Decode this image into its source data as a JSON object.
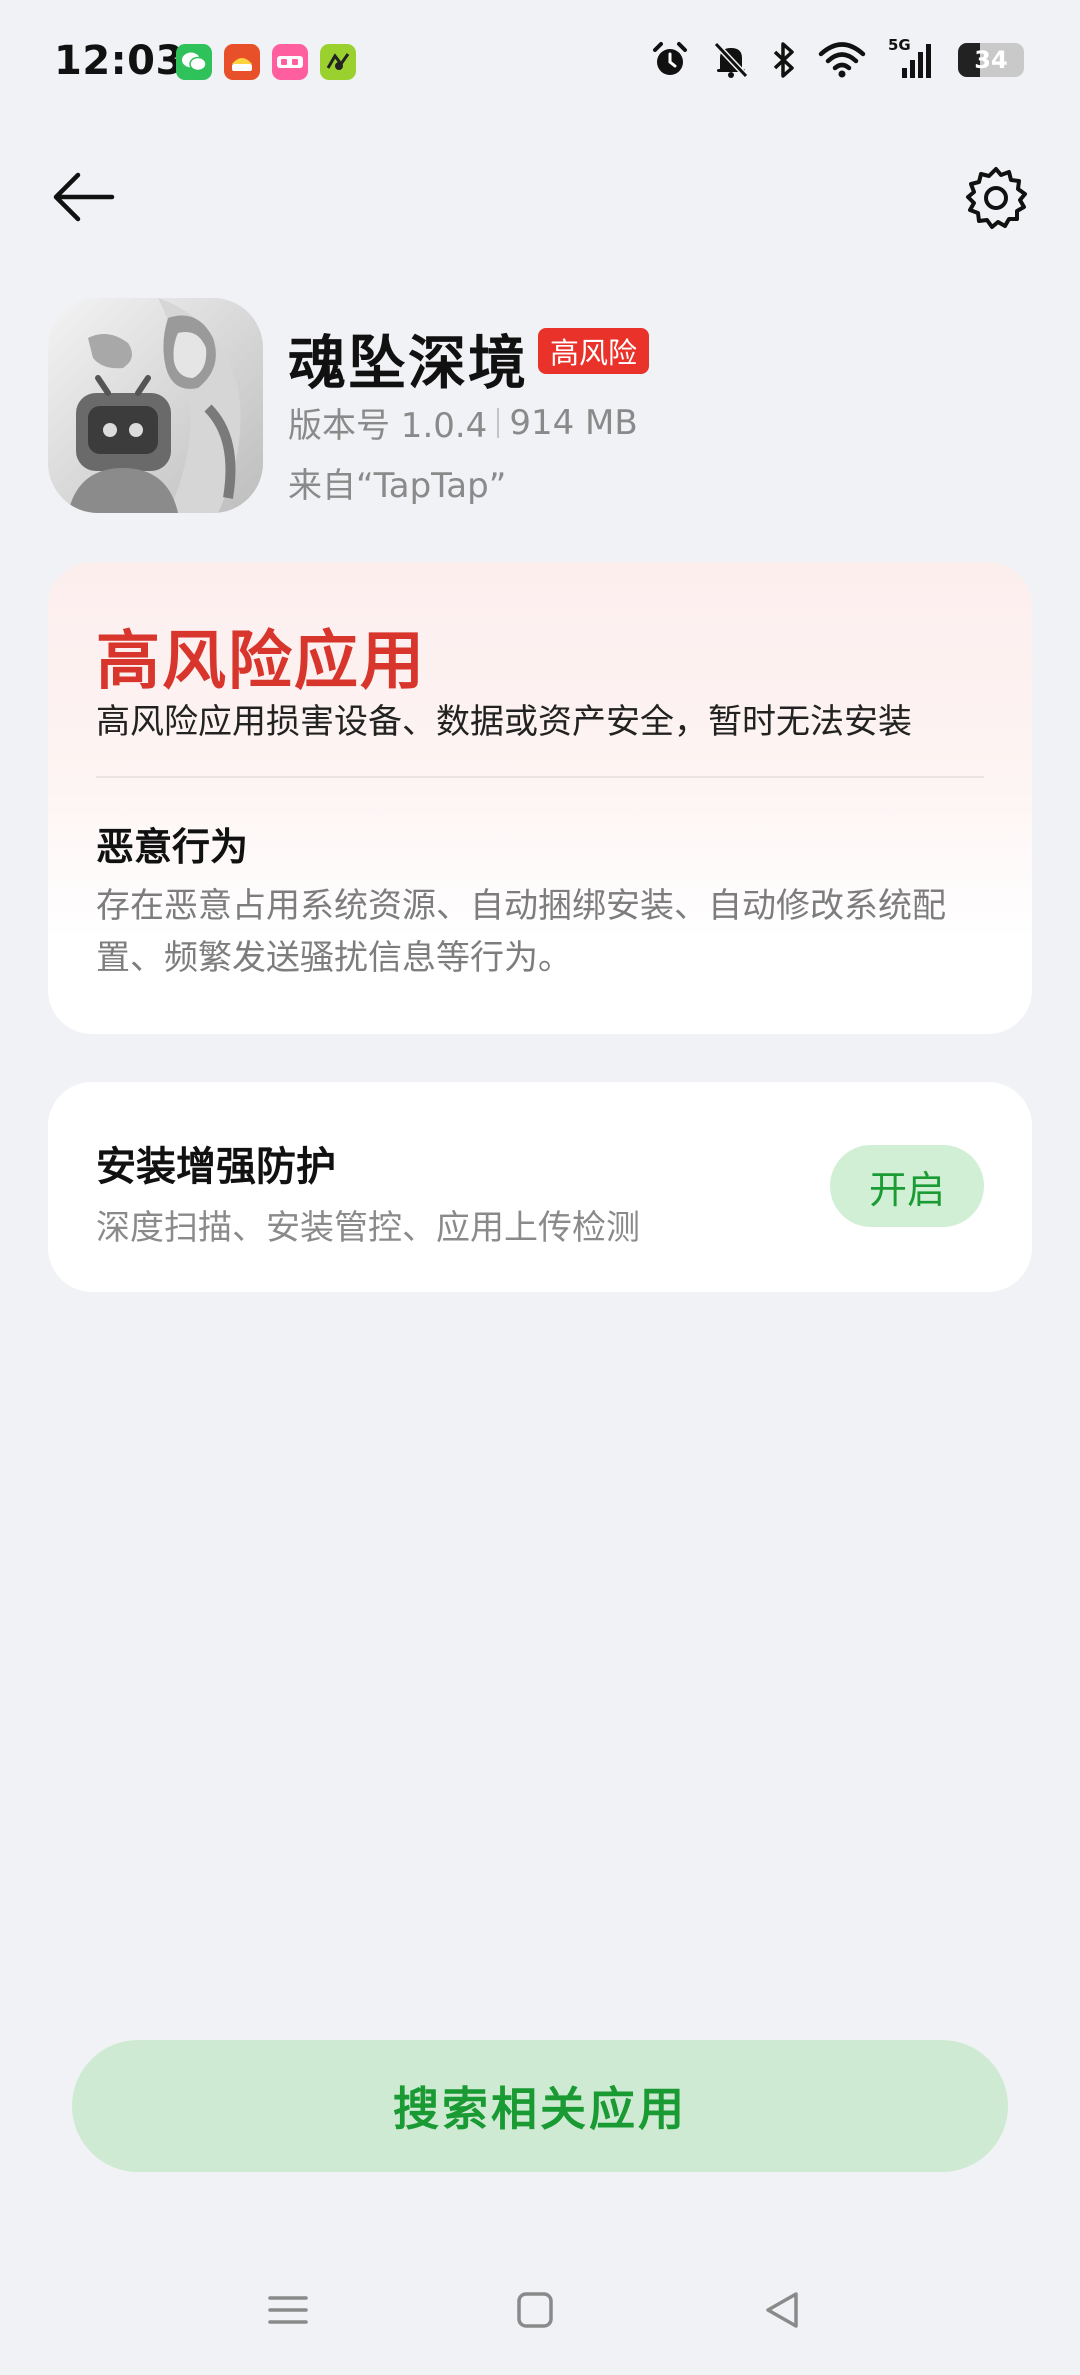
{
  "status_bar": {
    "time": "12:03",
    "battery_level": "34",
    "network": "5G",
    "notification_icons": [
      "wechat-icon",
      "app-notification-icon",
      "lala-icon",
      "game-icon"
    ],
    "system_icons": [
      "alarm-icon",
      "bell-muted-icon",
      "bluetooth-icon",
      "wifi-icon",
      "signal-5g-icon",
      "battery-icon"
    ]
  },
  "nav": {
    "back_icon": "arrow-left-icon",
    "settings_icon": "gear-icon"
  },
  "app": {
    "name": "魂坠深境",
    "risk_badge": "高风险",
    "version": "版本号 1.0.4",
    "size": "914 MB",
    "source": "来自“TapTap”"
  },
  "risk_card": {
    "title": "高风险应用",
    "description": "高风险应用损害设备、数据或资产安全，暂时无法安装",
    "behavior_title": "恶意行为",
    "behavior_description": "存在恶意占用系统资源、自动捆绑安装、自动修改系统配置、频繁发送骚扰信息等行为。"
  },
  "protection": {
    "title": "安装增强防护",
    "description": "深度扫描、安装管控、应用上传检测",
    "button_label": "开启"
  },
  "actions": {
    "search_label": "搜索相关应用"
  },
  "colors": {
    "danger": "#d8352d",
    "badge": "#e8322a",
    "accent_green": "#1b9b33",
    "green_bg": "#d1efd5",
    "page_bg": "#f1f2f5"
  }
}
